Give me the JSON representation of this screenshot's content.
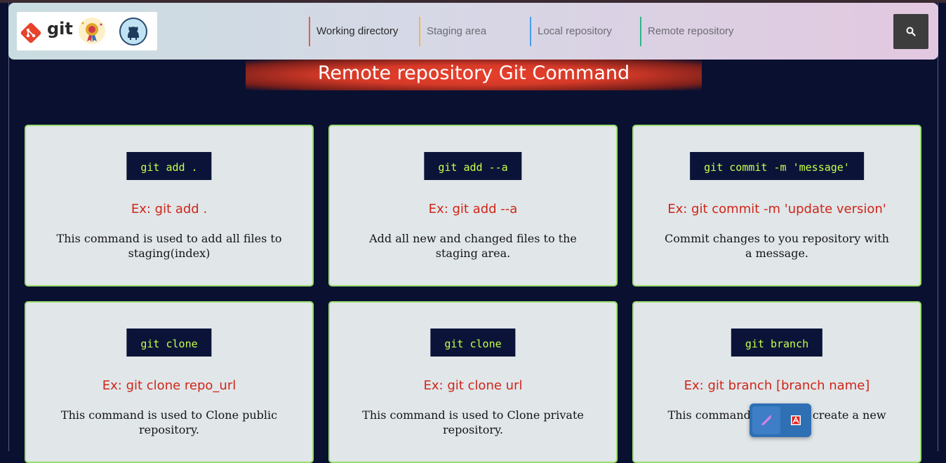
{
  "nav": {
    "links": [
      {
        "label": "Working directory",
        "color": "#e85a4f"
      },
      {
        "label": "Staging area",
        "color": "#f2b650"
      },
      {
        "label": "Local repository",
        "color": "#4a9ee8"
      },
      {
        "label": "Remote repository",
        "color": "#2fb58c"
      }
    ],
    "search_icon": "search-icon",
    "logo_text": "git"
  },
  "banner": {
    "title": "Remote repository Git Command"
  },
  "cards": [
    {
      "command": "git add .",
      "example": "Ex: git add .",
      "description": "This command is used to add all files to staging(index)"
    },
    {
      "command": "git add --a",
      "example": "Ex: git add --a",
      "description": "Add all new and changed files to the staging area."
    },
    {
      "command": "git commit -m 'message'",
      "example": "Ex: git commit -m 'update version'",
      "description": "Commit changes to you repository with a message."
    },
    {
      "command": "git clone",
      "example": "Ex: git clone repo_url",
      "description": "This command is used to Clone public repository."
    },
    {
      "command": "git clone",
      "example": "Ex: git clone url",
      "description": "This command is used to Clone private repository."
    },
    {
      "command": "git branch",
      "example": "Ex: git branch [branch name]",
      "description": "This command is used to create a new"
    }
  ],
  "colors": {
    "accent_green": "#c6ff4a",
    "example_red": "#cf2618",
    "card_border": "#9adf6f"
  }
}
